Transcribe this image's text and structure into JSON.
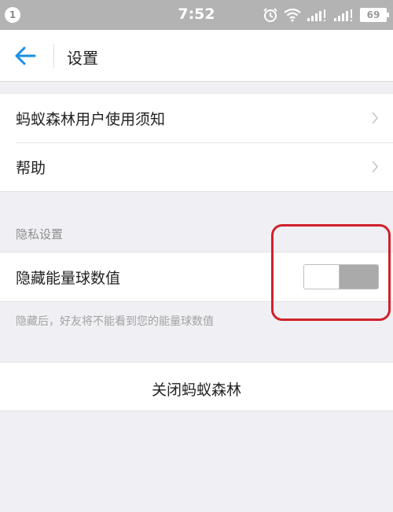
{
  "status_bar": {
    "notification_count": "1",
    "time": "7:52",
    "battery": "69",
    "icons": [
      "alarm-icon",
      "wifi-icon",
      "signal-icon",
      "signal-icon"
    ]
  },
  "nav": {
    "title": "设置",
    "back_icon": "back-arrow-icon",
    "accent_color": "#1a8fe3"
  },
  "general": {
    "items": [
      {
        "label": "蚂蚁森林用户使用须知",
        "icon": "chevron-right-icon"
      },
      {
        "label": "帮助",
        "icon": "chevron-right-icon"
      }
    ]
  },
  "privacy": {
    "header": "隐私设置",
    "toggle_label": "隐藏能量球数值",
    "toggle_on": false,
    "footnote": "隐藏后，好友将不能看到您的能量球数值"
  },
  "actions": {
    "close_label": "关闭蚂蚁森林"
  },
  "annotation": {
    "highlight_color": "#d0212b"
  }
}
